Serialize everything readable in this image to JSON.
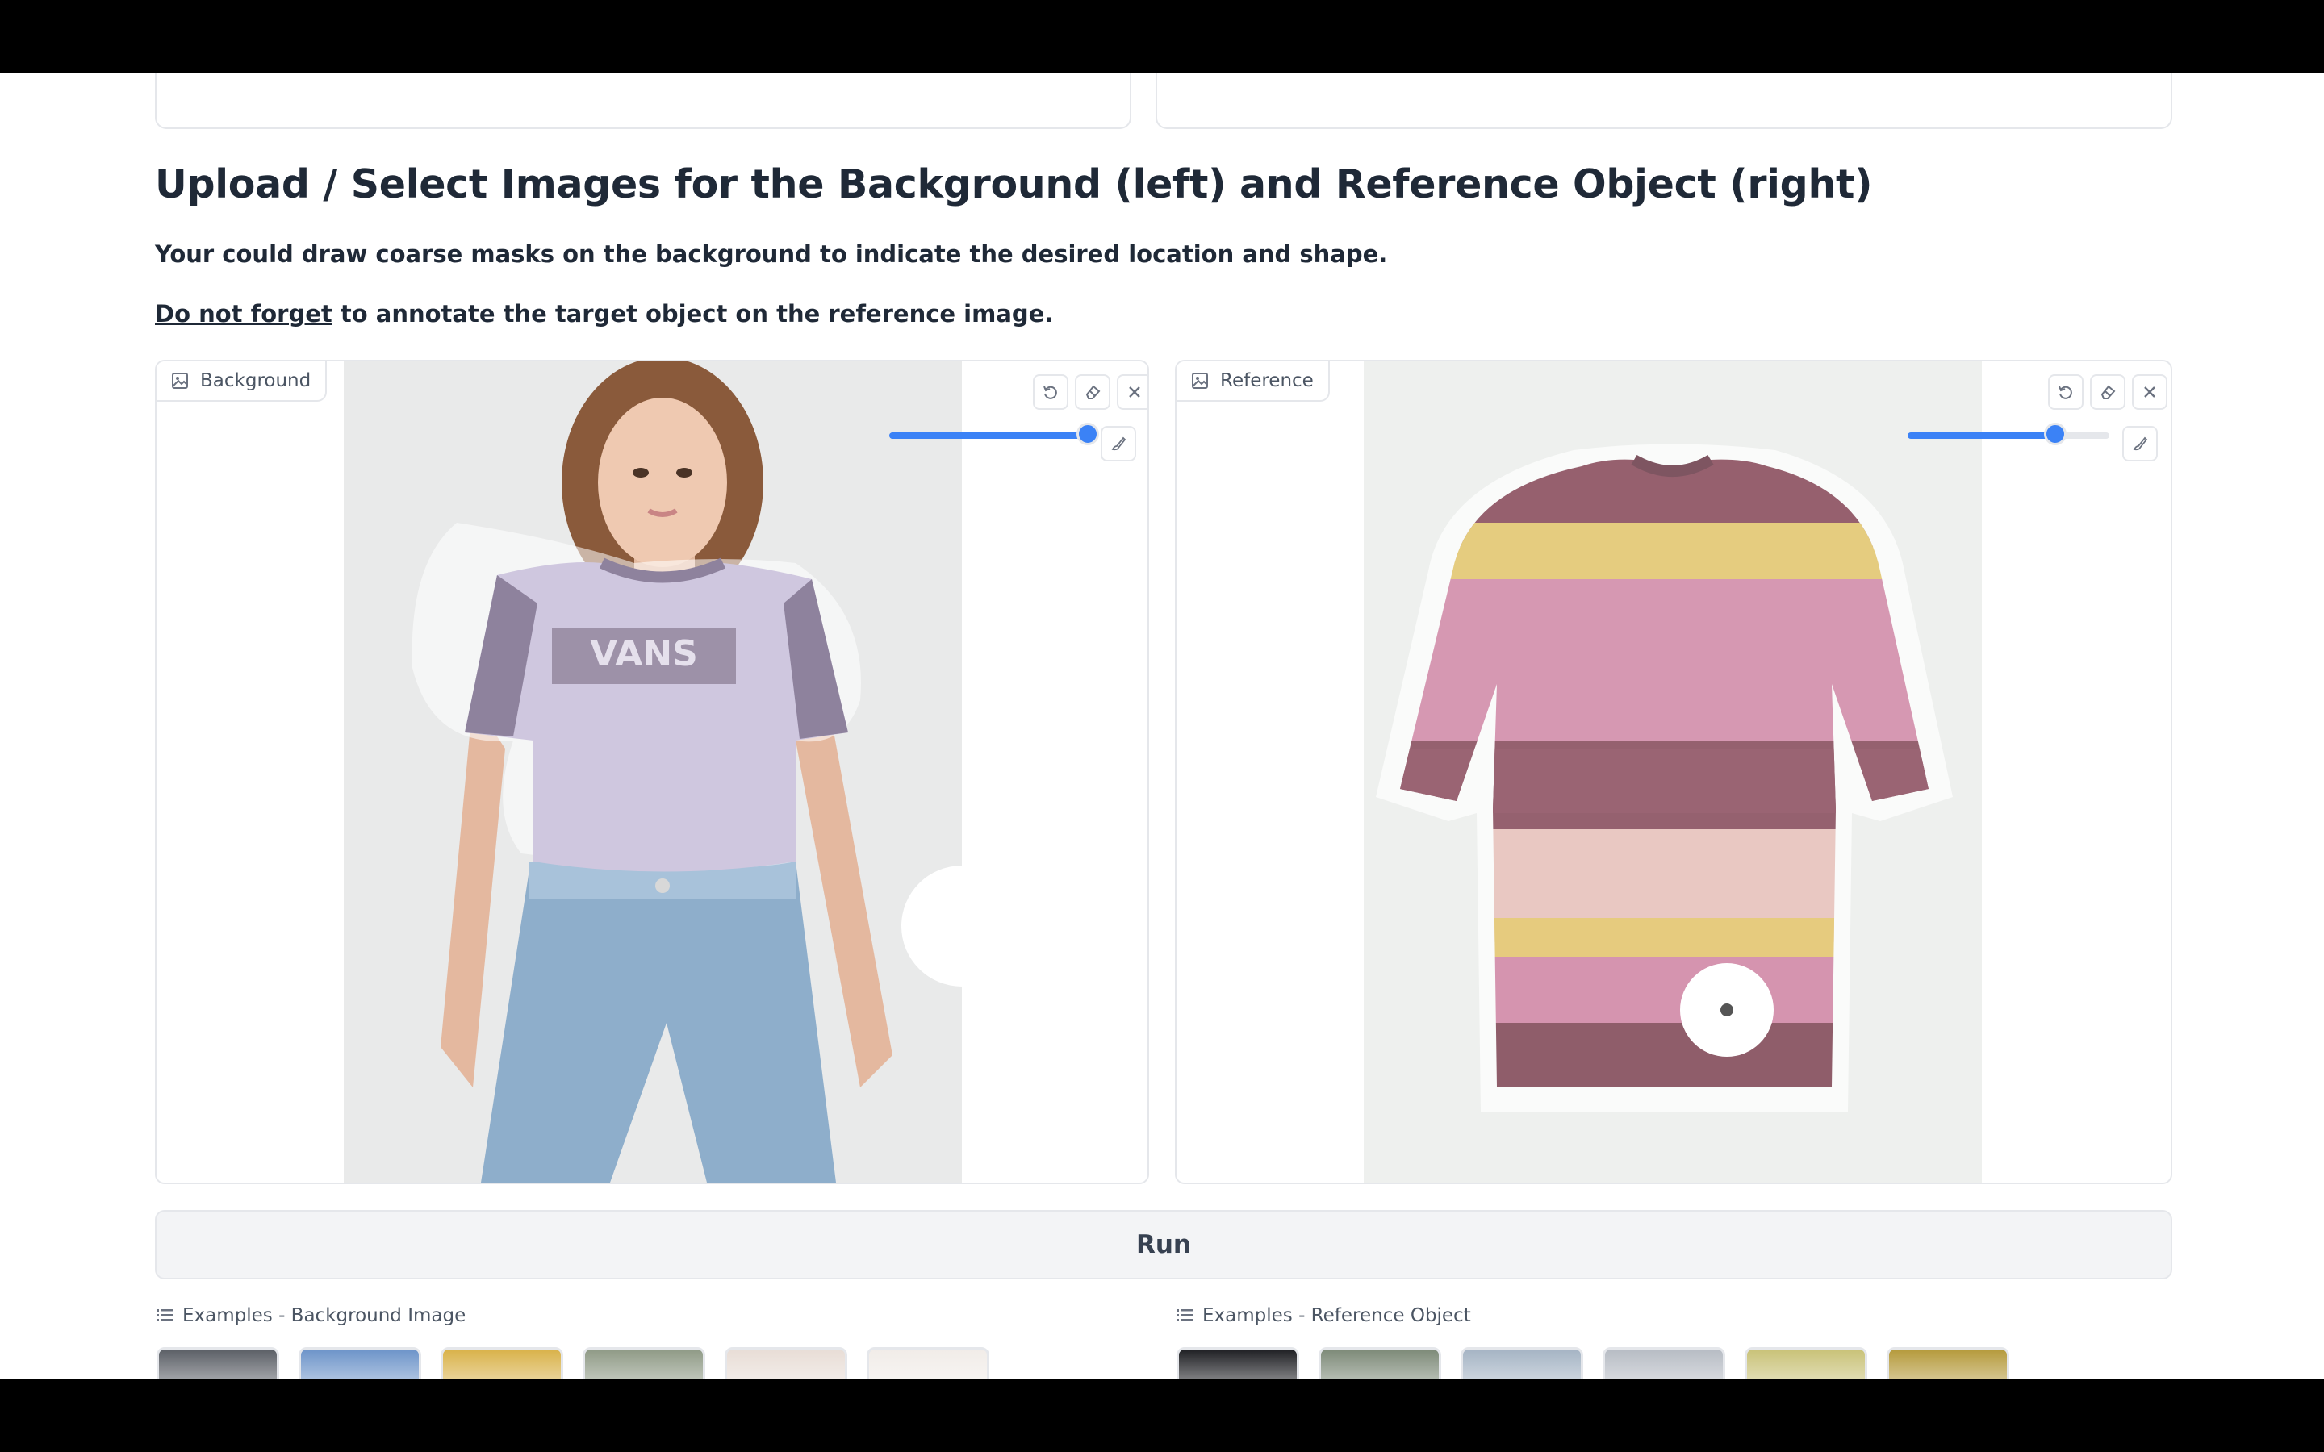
{
  "heading": "Upload / Select Images for the Background (left) and Reference Object (right)",
  "instruction_1": "Your could draw coarse masks on the background to indicate the desired location and shape.",
  "instruction_2_link": "Do not forget",
  "instruction_2_rest": " to annotate the target object on the reference image.",
  "background_panel": {
    "label": "Background",
    "icons": [
      "image-icon",
      "undo-icon",
      "eraser-icon",
      "close-icon",
      "brush-icon"
    ],
    "brush_size_fraction": 1.0,
    "logo_text": "VANS"
  },
  "reference_panel": {
    "label": "Reference",
    "icons": [
      "image-icon",
      "undo-icon",
      "eraser-icon",
      "close-icon",
      "brush-icon"
    ],
    "brush_size_fraction": 0.73
  },
  "run_button": "Run",
  "examples_background": {
    "label": "Examples - Background Image",
    "thumb_colors": [
      "#5b5f66",
      "#6d94c9",
      "#d9b24a",
      "#8f9a86",
      "#e8ddd6",
      "#f1ece8"
    ]
  },
  "examples_reference": {
    "label": "Examples - Reference Object",
    "thumb_colors": [
      "#1f2024",
      "#7d8a78",
      "#a5b4c4",
      "#b7bcc4",
      "#c9c278",
      "#b59a3c"
    ]
  },
  "colors": {
    "accent": "#3b82f6",
    "border": "#e5e7eb",
    "run_bg": "#f3f4f6"
  }
}
